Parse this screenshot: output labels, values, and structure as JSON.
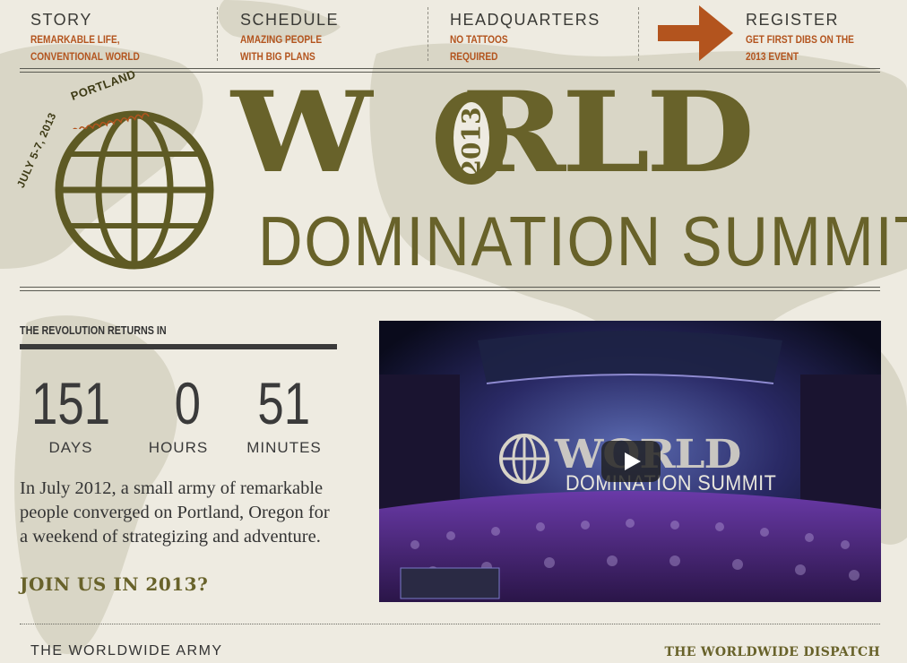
{
  "nav": {
    "items": [
      {
        "title": "STORY",
        "line1": "REMARKABLE LIFE,",
        "line2": "CONVENTIONAL WORLD"
      },
      {
        "title": "SCHEDULE",
        "line1": "AMAZING PEOPLE",
        "line2": "WITH BIG PLANS"
      },
      {
        "title": "HEADQUARTERS",
        "line1": "NO TATTOOS",
        "line2": "REQUIRED"
      },
      {
        "title": "REGISTER",
        "line1": "GET FIRST DIBS ON THE",
        "line2": "2013 EVENT"
      }
    ]
  },
  "logo": {
    "location": "PORTLAND",
    "dates": "JULY 5-7, 2013",
    "world_left": "W",
    "world_right": "RLD",
    "year": "2013",
    "subtitle": "DOMINATION SUMMIT"
  },
  "countdown": {
    "label": "THE REVOLUTION RETURNS IN",
    "days": {
      "value": "151",
      "label": "DAYS"
    },
    "hours": {
      "value": "0",
      "label": "HOURS"
    },
    "minutes": {
      "value": "51",
      "label": "MINUTES"
    }
  },
  "intro": {
    "text": "In July 2012, a small army of remarkable people converged on Portland, Oregon for a weekend of strategizing and adventure.",
    "cta": "JOIN US IN 2013?"
  },
  "video": {
    "title": "WORLD",
    "subtitle": "DOMINATION SUMMIT"
  },
  "footer": {
    "left": "THE WORLDWIDE ARMY",
    "right": "THE WORLDWIDE DISPATCH"
  },
  "colors": {
    "background": "#eeebe1",
    "brand_olive": "#68622a",
    "nav_orange": "#b3541e",
    "text_dark": "#3a3a3a"
  }
}
